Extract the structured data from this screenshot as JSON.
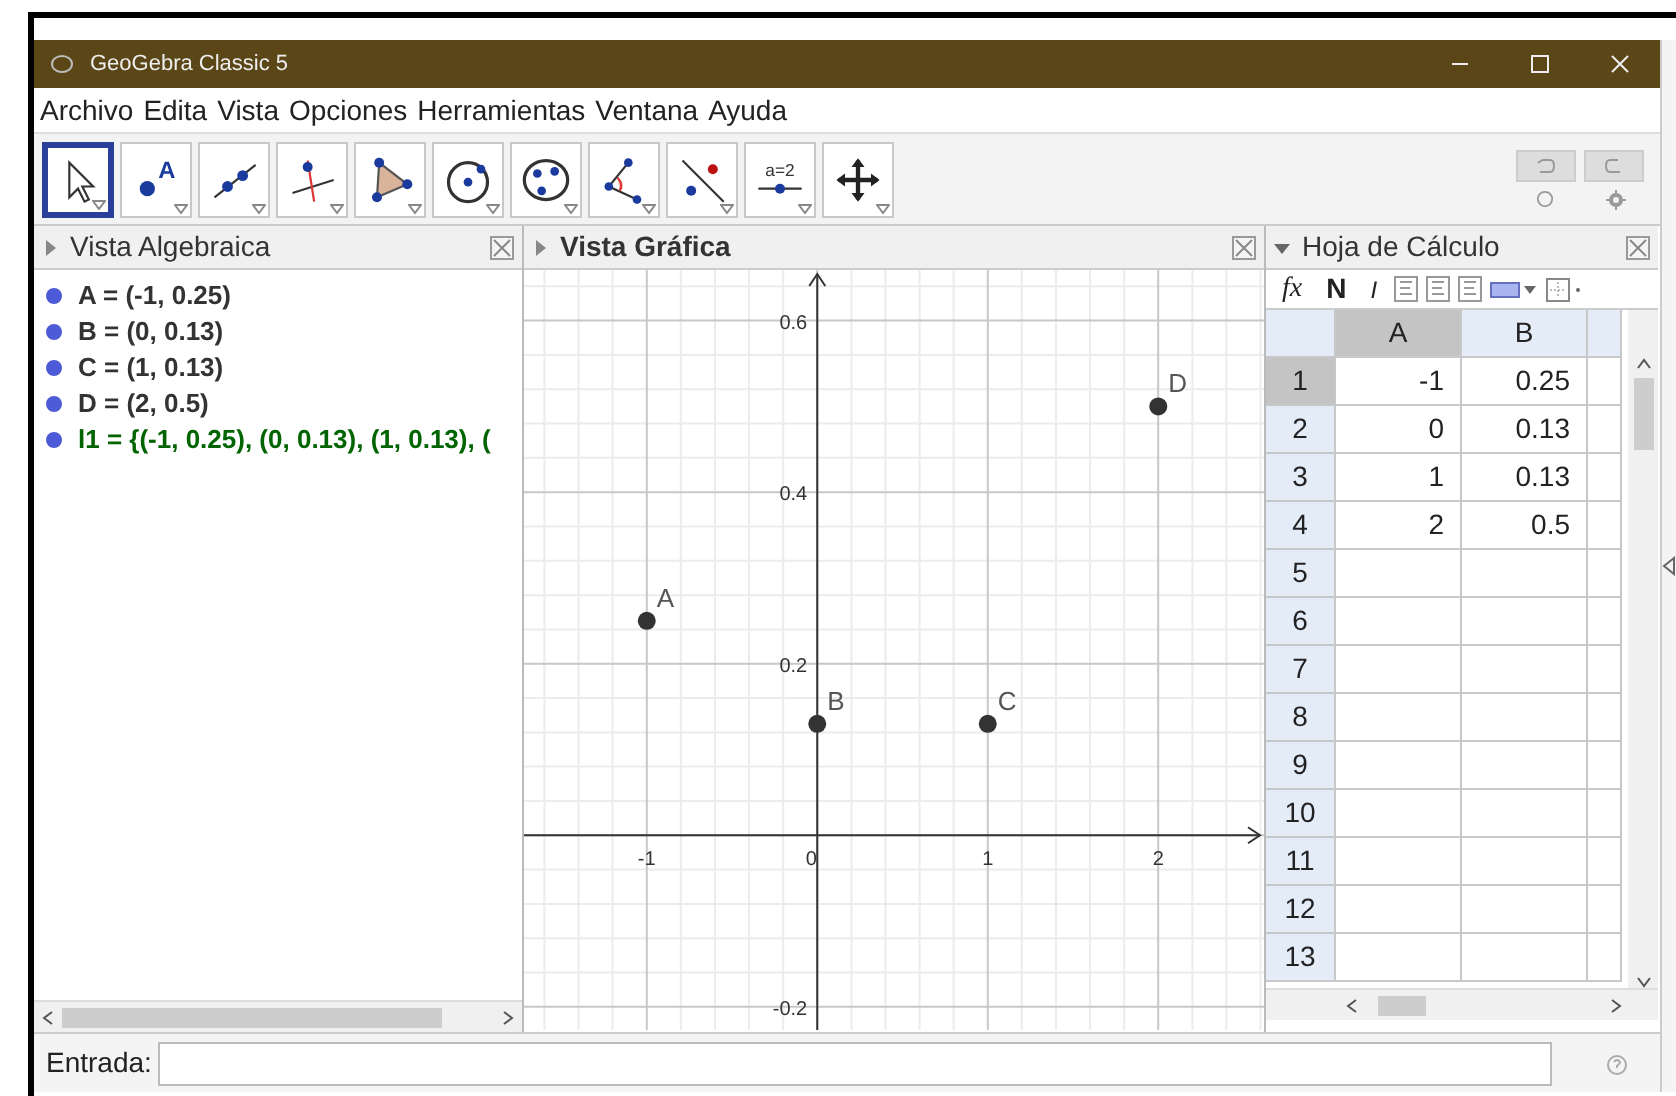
{
  "window": {
    "title": "GeoGebra Classic 5"
  },
  "menu": [
    {
      "label": "Archivo"
    },
    {
      "label": "Edita"
    },
    {
      "label": "Vista"
    },
    {
      "label": "Opciones"
    },
    {
      "label": "Herramientas"
    },
    {
      "label": "Ventana"
    },
    {
      "label": "Ayuda"
    }
  ],
  "toolbar": {
    "tools": [
      {
        "kind": "move",
        "selected": true
      },
      {
        "kind": "point",
        "label": "A",
        "selected": false
      },
      {
        "kind": "line",
        "selected": false
      },
      {
        "kind": "perpendicular",
        "selected": false
      },
      {
        "kind": "polygon",
        "selected": false
      },
      {
        "kind": "circle",
        "selected": false
      },
      {
        "kind": "conic",
        "selected": false
      },
      {
        "kind": "angle",
        "selected": false
      },
      {
        "kind": "reflect",
        "selected": false
      },
      {
        "kind": "slider",
        "label": "a=2",
        "selected": false
      },
      {
        "kind": "pan",
        "selected": false
      }
    ]
  },
  "algebra_view": {
    "title": "Vista Algebraica",
    "focused": false,
    "style_bar_open": false,
    "items": [
      {
        "text": "A = (-1, 0.25)",
        "color": "#333333"
      },
      {
        "text": "B = (0, 0.13)",
        "color": "#333333"
      },
      {
        "text": "C = (1, 0.13)",
        "color": "#333333"
      },
      {
        "text": "D = (2, 0.5)",
        "color": "#333333"
      },
      {
        "text": "l1 = {(-1, 0.25), (0, 0.13), (1, 0.13), (",
        "color": "#006400"
      }
    ]
  },
  "graphics_view": {
    "title": "Vista Gráfica",
    "focused": true,
    "style_bar_open": false,
    "chart_data": {
      "type": "scatter",
      "x": [
        -1,
        0,
        1,
        2
      ],
      "series": [
        {
          "color": "#333333",
          "values": [
            0.25,
            0.13,
            0.13,
            0.5
          ]
        }
      ],
      "xlim": [
        -1.72,
        2.62
      ],
      "ylim": [
        -0.227,
        0.659
      ],
      "grid": true,
      "xticks": [
        -1,
        0,
        1,
        2
      ],
      "yticks": [
        -0.2,
        0.2,
        0.4,
        0.6
      ],
      "annotations": [
        {
          "x": -1,
          "y": 0.25,
          "text": "A"
        },
        {
          "x": 0,
          "y": 0.13,
          "text": "B"
        },
        {
          "x": 1,
          "y": 0.13,
          "text": "C"
        },
        {
          "x": 2,
          "y": 0.5,
          "text": "D"
        }
      ]
    }
  },
  "spreadsheet_view": {
    "title": "Hoja de Cálculo",
    "focused": false,
    "style_bar_open": true,
    "style_bar": [
      {
        "kind": "formula",
        "label": "fx"
      },
      {
        "kind": "bold",
        "label": "N"
      },
      {
        "kind": "italic",
        "label": "I"
      }
    ],
    "columns": [
      {
        "label": "A",
        "selected": true
      },
      {
        "label": "B",
        "selected": false
      }
    ],
    "rows": [
      {
        "label": "1",
        "selected": true,
        "cells": [
          "-1",
          "0.25"
        ]
      },
      {
        "label": "2",
        "selected": false,
        "cells": [
          "0",
          "0.13"
        ]
      },
      {
        "label": "3",
        "selected": false,
        "cells": [
          "1",
          "0.13"
        ]
      },
      {
        "label": "4",
        "selected": false,
        "cells": [
          "2",
          "0.5"
        ]
      },
      {
        "label": "5",
        "selected": false,
        "cells": []
      },
      {
        "label": "6",
        "selected": false,
        "cells": []
      },
      {
        "label": "7",
        "selected": false,
        "cells": []
      },
      {
        "label": "8",
        "selected": false,
        "cells": []
      },
      {
        "label": "9",
        "selected": false,
        "cells": []
      },
      {
        "label": "10",
        "selected": false,
        "cells": []
      },
      {
        "label": "11",
        "selected": false,
        "cells": []
      },
      {
        "label": "12",
        "selected": false,
        "cells": []
      },
      {
        "label": "13",
        "selected": false,
        "cells": []
      }
    ]
  },
  "input_bar": {
    "label": "Entrada:"
  }
}
